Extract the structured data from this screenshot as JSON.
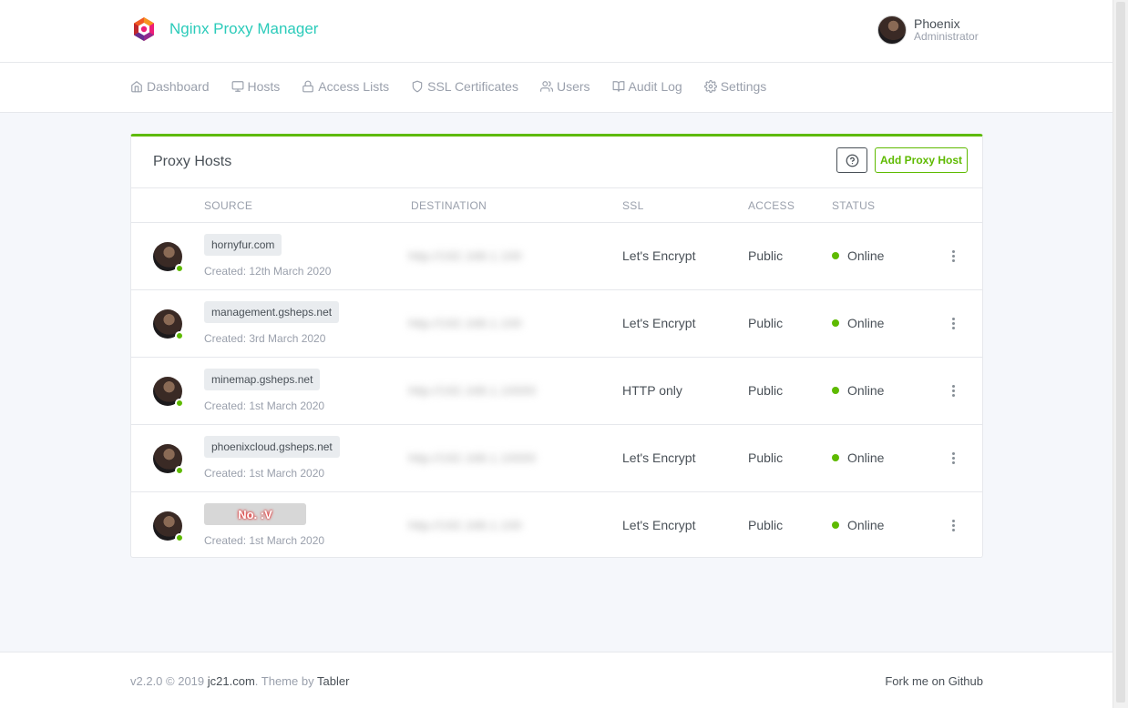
{
  "app": {
    "title": "Nginx Proxy Manager"
  },
  "user": {
    "name": "Phoenix",
    "role": "Administrator"
  },
  "nav": [
    {
      "label": "Dashboard",
      "icon": "home-icon"
    },
    {
      "label": "Hosts",
      "icon": "monitor-icon"
    },
    {
      "label": "Access Lists",
      "icon": "lock-icon"
    },
    {
      "label": "SSL Certificates",
      "icon": "shield-icon"
    },
    {
      "label": "Users",
      "icon": "users-icon"
    },
    {
      "label": "Audit Log",
      "icon": "book-icon"
    },
    {
      "label": "Settings",
      "icon": "gear-icon"
    }
  ],
  "card": {
    "title": "Proxy Hosts",
    "add_label": "Add Proxy Host",
    "columns": {
      "source": "Source",
      "destination": "Destination",
      "ssl": "SSL",
      "access": "Access",
      "status": "Status"
    }
  },
  "rows": [
    {
      "domain": "hornyfur.com",
      "created": "Created: 12th March 2020",
      "ssl": "Let's Encrypt",
      "access": "Public",
      "status": "Online"
    },
    {
      "domain": "management.gsheps.net",
      "created": "Created: 3rd March 2020",
      "ssl": "Let's Encrypt",
      "access": "Public",
      "status": "Online"
    },
    {
      "domain": "minemap.gsheps.net",
      "created": "Created: 1st March 2020",
      "ssl": "HTTP only",
      "access": "Public",
      "status": "Online"
    },
    {
      "domain": "phoenixcloud.gsheps.net",
      "created": "Created: 1st March 2020",
      "ssl": "Let's Encrypt",
      "access": "Public",
      "status": "Online"
    },
    {
      "domain": "No. :V",
      "created": "Created: 1st March 2020",
      "ssl": "Let's Encrypt",
      "access": "Public",
      "status": "Online"
    }
  ],
  "footer": {
    "version": "v2.2.0 © 2019",
    "author": "jc21.com",
    "theme_prefix": ". Theme by",
    "theme": "Tabler",
    "fork": "Fork me on Github"
  },
  "colors": {
    "accent": "#2bcbba",
    "success": "#5eba00",
    "text": "#495057",
    "muted": "#9aa0ac"
  }
}
